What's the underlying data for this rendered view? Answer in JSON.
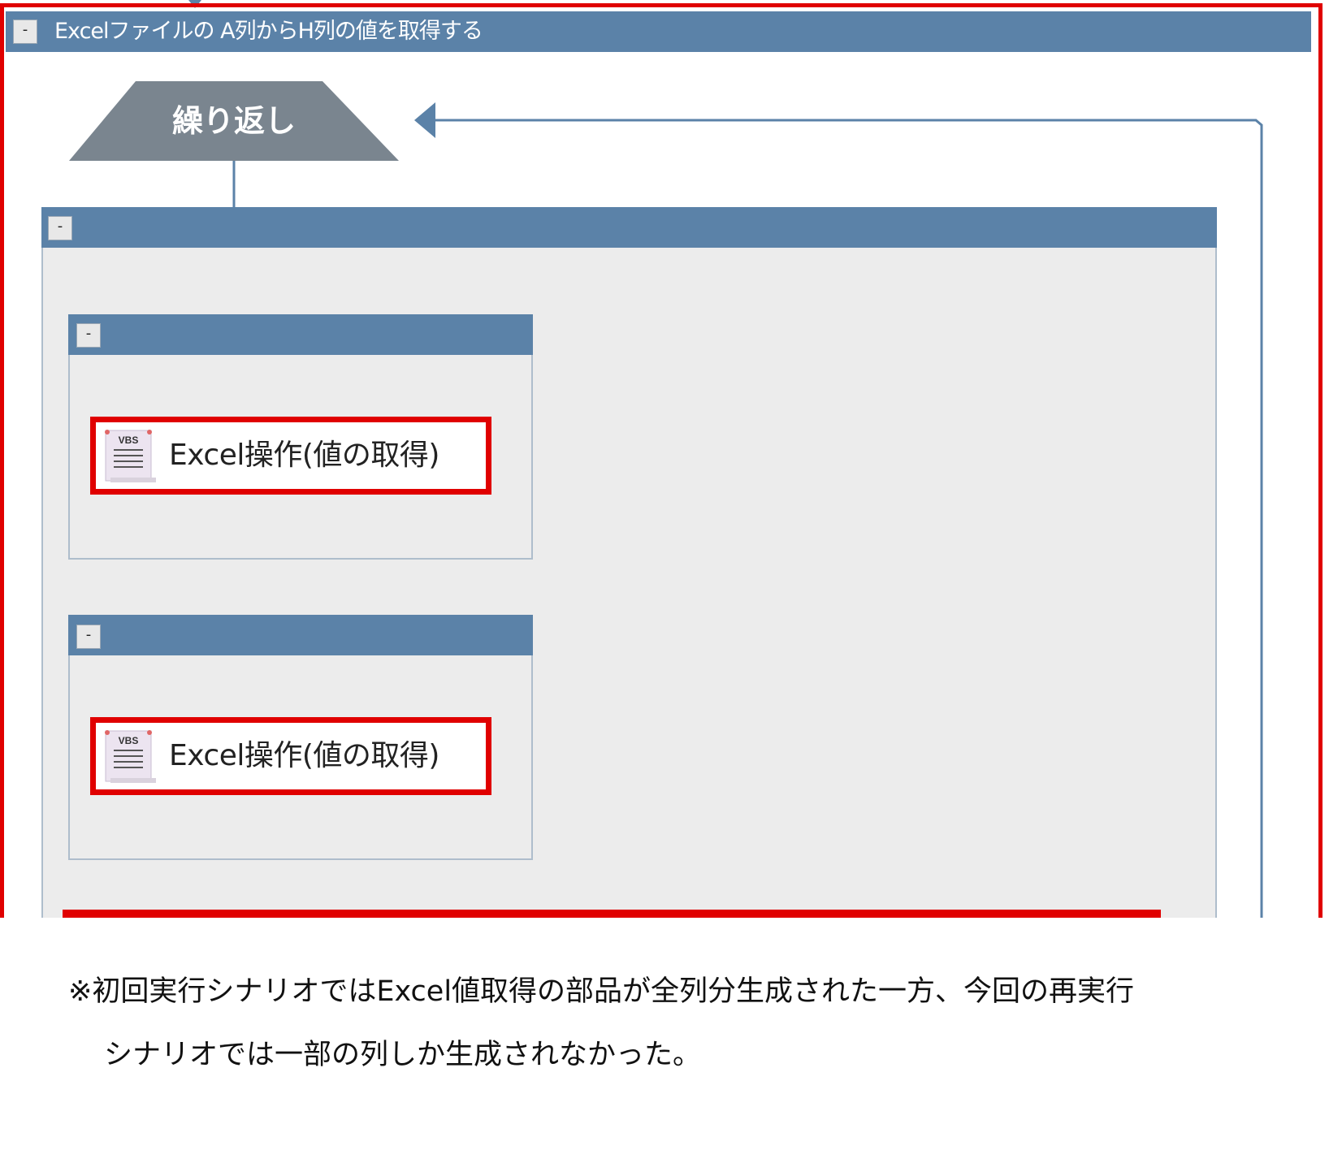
{
  "outer_group": {
    "title": "Excelファイルの A列からH列の値を取得する",
    "collapse_toggle": "-"
  },
  "loop": {
    "label": "繰り返し"
  },
  "inner_group": {
    "collapse_toggle": "-"
  },
  "sub_groups": [
    {
      "collapse_toggle": "-",
      "action_label": "Excel操作(値の取得)",
      "action_icon": "VBS"
    },
    {
      "collapse_toggle": "-",
      "action_label": "Excel操作(値の取得)",
      "action_icon": "VBS"
    }
  ],
  "note": {
    "line1": "※初回実行シナリオではExcel値取得の部品が全列分生成された一方、今回の再実行",
    "line2": "シナリオでは一部の列しか生成されなかった。"
  },
  "colors": {
    "header_blue": "#5b82a8",
    "highlight_red": "#e00000",
    "loop_grey": "#7a858f",
    "connector_blue": "#5b82a8",
    "group_bg": "#ececec"
  }
}
